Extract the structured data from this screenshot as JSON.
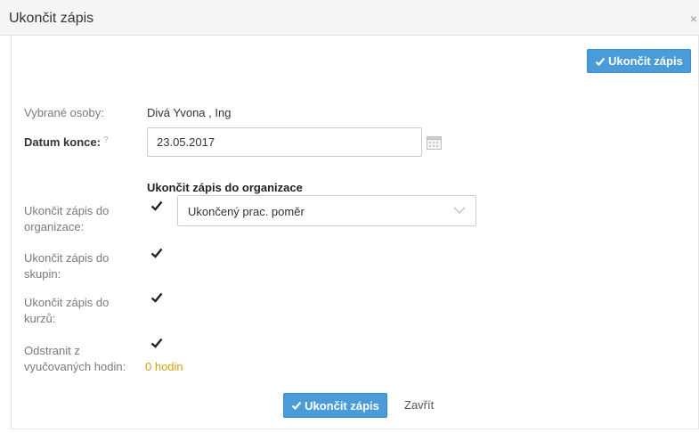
{
  "dialog": {
    "title": "Ukončit zápis",
    "close_glyph": "×"
  },
  "toolbar": {
    "top_button_label": "Ukončit zápis"
  },
  "form": {
    "selected_persons_label": "Vybrané osoby:",
    "selected_persons_value": "Divá Yvona , Ing",
    "end_date_label": "Datum konce:",
    "end_date_help": "?",
    "end_date_value": "23.05.2017",
    "section_heading": "Ukončit zápis do organizace",
    "org_label_line1": "Ukončit zápis do",
    "org_label_line2": "organizace:",
    "org_checked": true,
    "org_reason_selected": "Ukončený prac. poměr",
    "groups_label_line1": "Ukončit zápis do",
    "groups_label_line2": "skupin:",
    "groups_checked": true,
    "courses_label_line1": "Ukončit zápis do",
    "courses_label_line2": "kurzů:",
    "courses_checked": true,
    "lessons_label_line1": "Odstranit z",
    "lessons_label_line2": "vyučovaných hodin:",
    "lessons_checked": true,
    "lessons_count": "0 hodin"
  },
  "footer": {
    "submit_label": "Ukončit zápis",
    "close_label": "Zavřít"
  },
  "colors": {
    "primary": "#4a9bd9",
    "accent_yellow": "#d4a017"
  },
  "icons": {
    "checkmark": "check-icon",
    "calendar": "calendar-icon",
    "chevron": "chevron-down-icon",
    "close": "close-icon"
  }
}
